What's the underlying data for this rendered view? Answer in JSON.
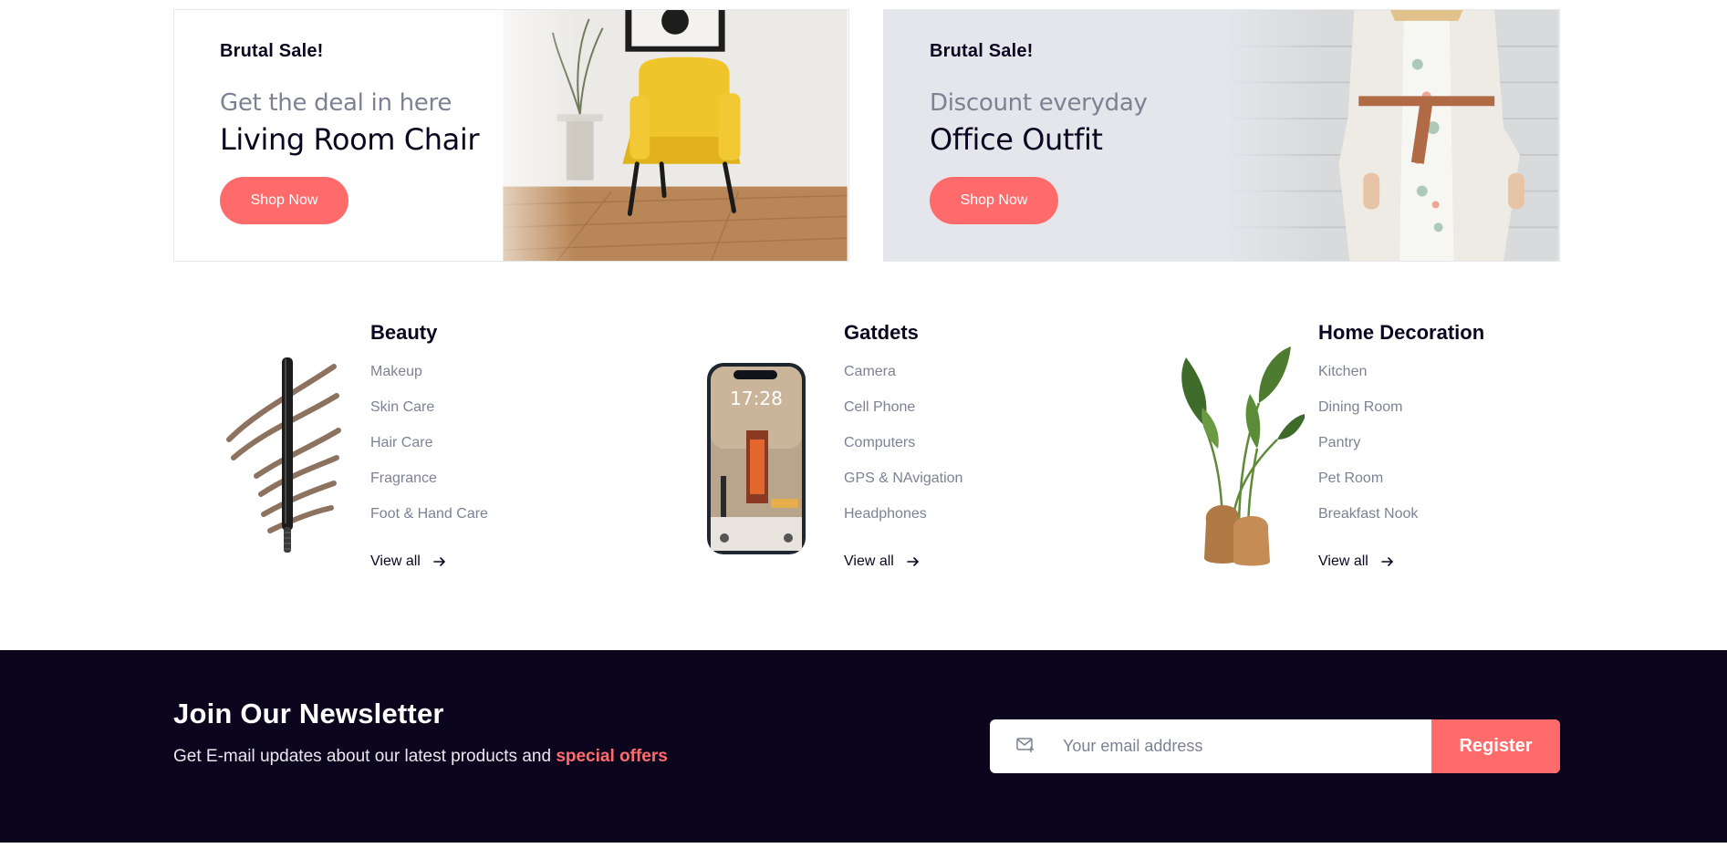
{
  "banners": [
    {
      "eyebrow": "Brutal Sale!",
      "subtitle": "Get the deal in here",
      "title": "Living Room Chair",
      "button": "Shop Now"
    },
    {
      "eyebrow": "Brutal Sale!",
      "subtitle": "Discount everyday",
      "title": "Office Outfit",
      "button": "Shop Now"
    }
  ],
  "categories": [
    {
      "title": "Beauty",
      "items": [
        "Makeup",
        "Skin Care",
        "Hair Care",
        "Fragrance",
        "Foot & Hand Care"
      ],
      "view_all": "View all",
      "image": "eyebrow-pencil"
    },
    {
      "title": "Gatdets",
      "items": [
        "Camera",
        "Cell Phone",
        "Computers",
        "GPS & NAvigation",
        "Headphones"
      ],
      "view_all": "View all",
      "image": "smartphone",
      "phone_time": "17:28"
    },
    {
      "title": "Home Decoration",
      "items": [
        "Kitchen",
        "Dining Room",
        "Pantry",
        "Pet Room",
        "Breakfast Nook"
      ],
      "view_all": "View all",
      "image": "potted-plant"
    }
  ],
  "newsletter": {
    "title": "Join Our Newsletter",
    "text": "Get E-mail updates about our latest products and ",
    "highlight": "special offers",
    "placeholder": "Your email address",
    "button": "Register",
    "icon": "mail-icon"
  },
  "colors": {
    "accent": "#ff6b6b",
    "dark": "#0c051e",
    "muted": "#7c8293"
  }
}
